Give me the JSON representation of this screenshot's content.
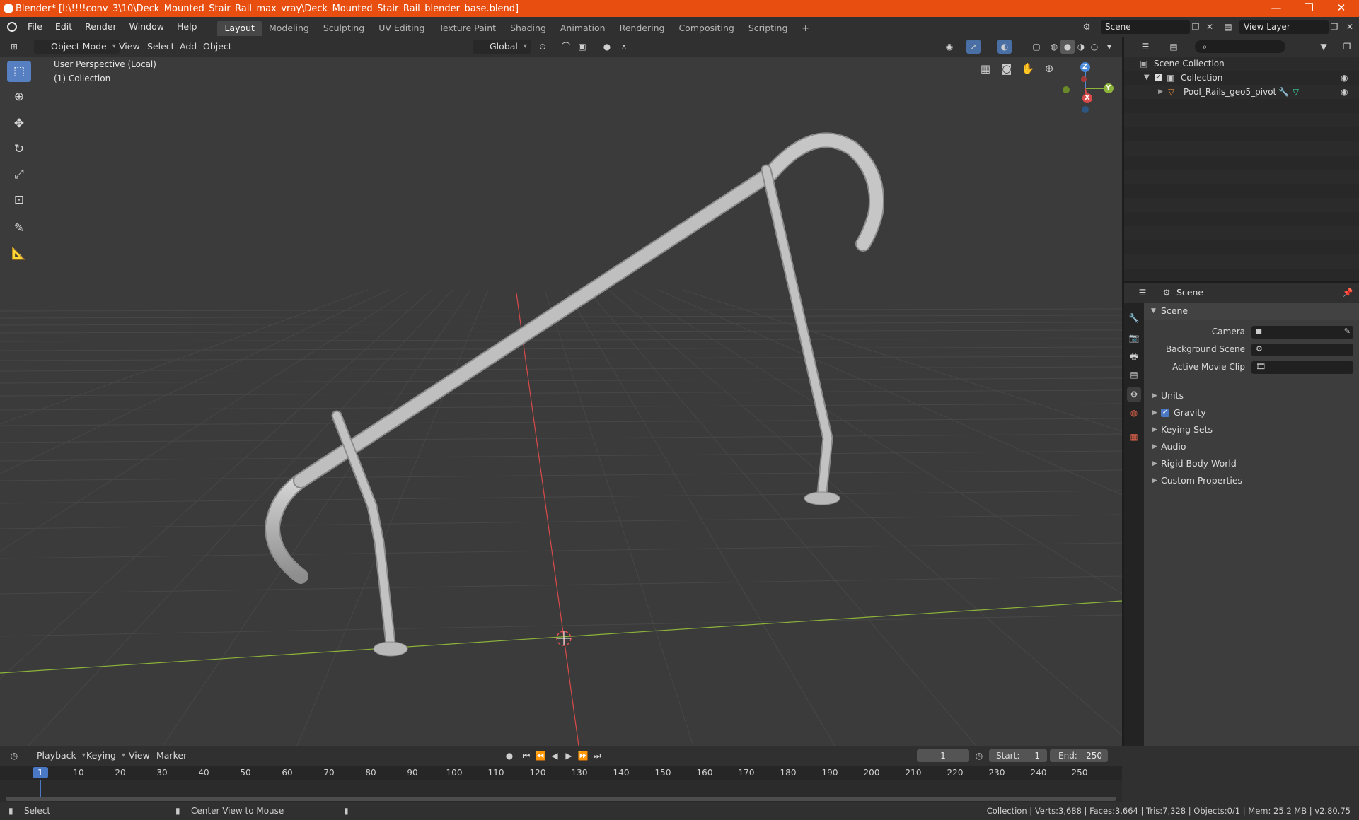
{
  "window": {
    "title": "Blender* [I:\\!!!!conv_3\\10\\Deck_Mounted_Stair_Rail_max_vray\\Deck_Mounted_Stair_Rail_blender_base.blend]",
    "minimize": "—",
    "maximize": "❐",
    "close": "✕"
  },
  "menubar": {
    "items": [
      "File",
      "Edit",
      "Render",
      "Window",
      "Help"
    ],
    "workspaces": [
      "Layout",
      "Modeling",
      "Sculpting",
      "UV Editing",
      "Texture Paint",
      "Shading",
      "Animation",
      "Rendering",
      "Compositing",
      "Scripting"
    ],
    "active_workspace": "Layout",
    "add_tab": "+",
    "scene_name": "Scene",
    "view_layer": "View Layer"
  },
  "viewport_header": {
    "mode": "Object Mode",
    "menus": [
      "View",
      "Select",
      "Add",
      "Object"
    ],
    "transform_orientation": "Global"
  },
  "viewport": {
    "perspective_label": "User Perspective (Local)",
    "collection_label": "(1) Collection",
    "gizmo_axes": {
      "z": "Z",
      "y": "Y",
      "x": "X"
    }
  },
  "outliner": {
    "root": "Scene Collection",
    "collection": "Collection",
    "object": "Pool_Rails_geo5_pivot"
  },
  "properties": {
    "context": "Scene",
    "panel_title": "Scene",
    "fields": [
      {
        "label": "Camera"
      },
      {
        "label": "Background Scene"
      },
      {
        "label": "Active Movie Clip"
      }
    ],
    "subpanels": [
      "Units",
      "Gravity",
      "Keying Sets",
      "Audio",
      "Rigid Body World",
      "Custom Properties"
    ],
    "gravity_enabled": true
  },
  "timeline": {
    "menus": [
      "Playback",
      "Keying",
      "View",
      "Marker"
    ],
    "current_frame": "1",
    "start_label": "Start:",
    "start": "1",
    "end_label": "End:",
    "end": "250",
    "ruler": [
      "1",
      "10",
      "20",
      "30",
      "40",
      "50",
      "60",
      "70",
      "80",
      "90",
      "100",
      "110",
      "120",
      "130",
      "140",
      "150",
      "160",
      "170",
      "180",
      "190",
      "200",
      "210",
      "220",
      "230",
      "240",
      "250"
    ]
  },
  "statusbar": {
    "left_hint": "Select",
    "middle_hint": "Center View to Mouse",
    "stats": "Collection | Verts:3,688 | Faces:3,664 | Tris:7,328 | Objects:0/1 | Mem: 25.2 MB | v2.80.75"
  },
  "colors": {
    "titlebar": "#e84e0f",
    "active_tool": "#5680c2",
    "x_axis": "#d94a4a",
    "y_axis": "#8cb33a",
    "z_axis": "#4a8ad9"
  }
}
